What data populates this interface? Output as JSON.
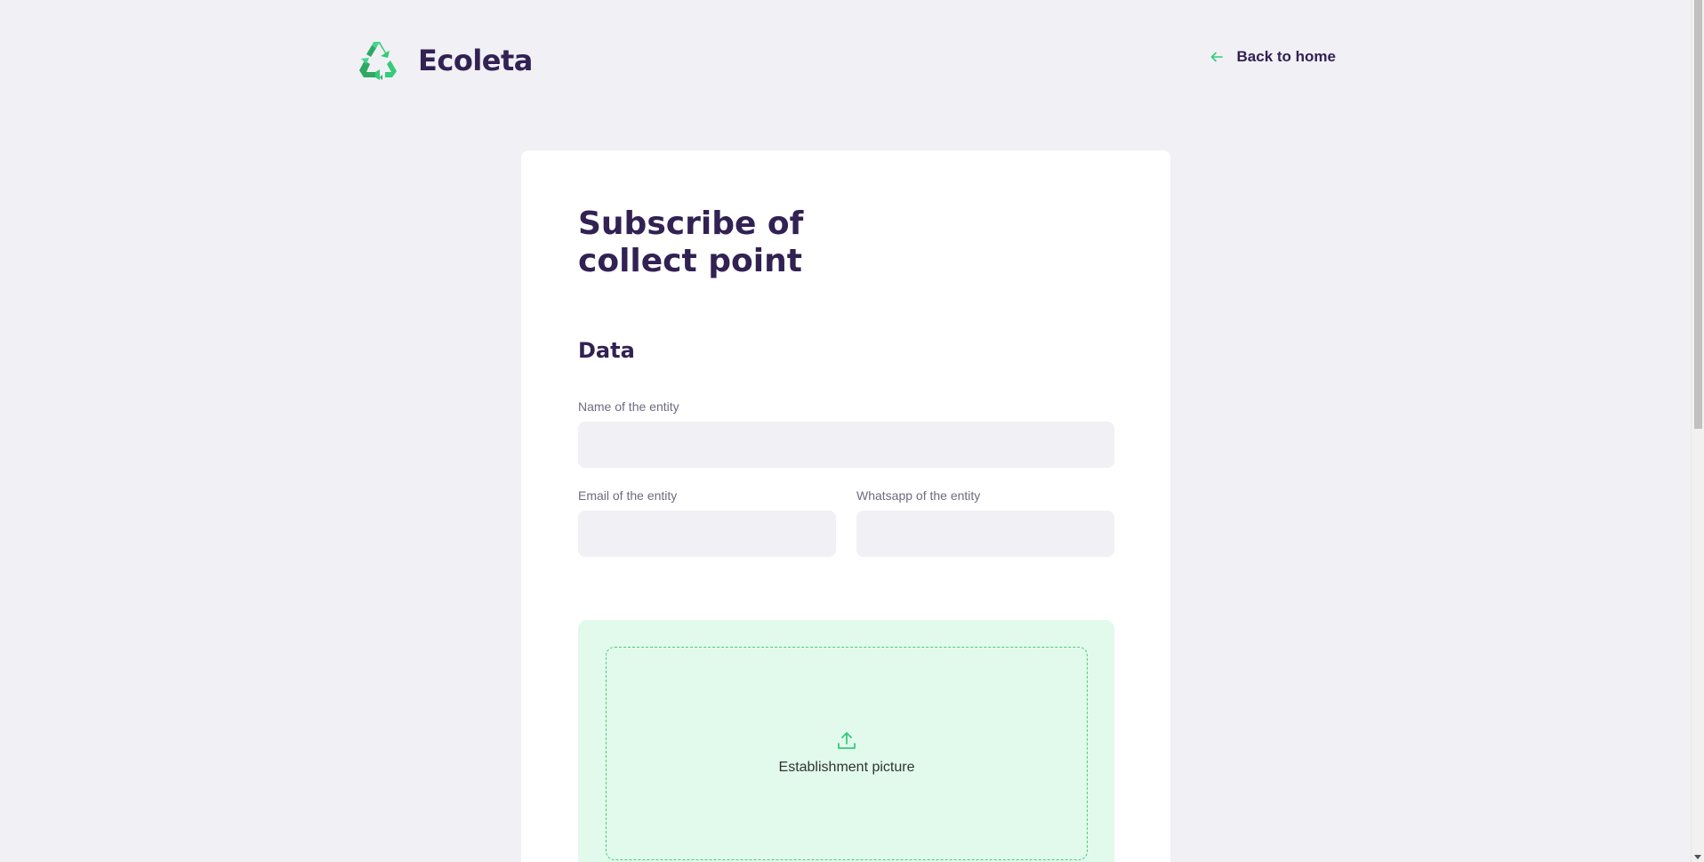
{
  "app": {
    "brand": "Ecoleta",
    "logo_icon": "recycle-icon",
    "accent_color": "#34CB79",
    "title_color": "#322153"
  },
  "header": {
    "back_link_label": "Back to home",
    "back_icon": "arrow-left-icon"
  },
  "form": {
    "title": "Subscribe of collect point",
    "section_data_title": "Data",
    "fields": {
      "name": {
        "label": "Name of the entity",
        "value": ""
      },
      "email": {
        "label": "Email of the entity",
        "value": ""
      },
      "whatsapp": {
        "label": "Whatsapp of the entity",
        "value": ""
      }
    },
    "dropzone": {
      "label": "Establishment picture",
      "icon": "upload-icon",
      "background": "#E1FAEC"
    }
  }
}
